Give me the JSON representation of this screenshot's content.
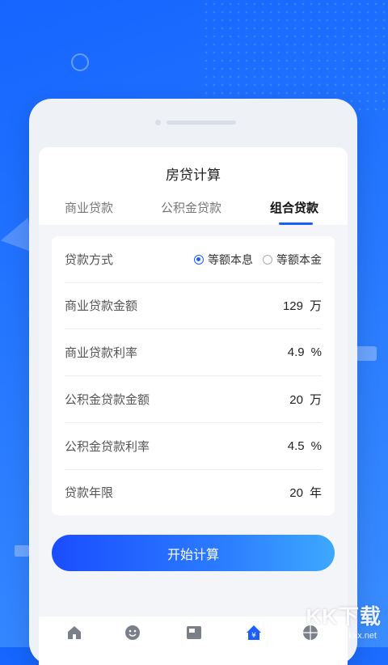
{
  "app": {
    "title": "房贷计算"
  },
  "tabs": [
    {
      "label": "商业贷款",
      "active": false
    },
    {
      "label": "公积金贷款",
      "active": false
    },
    {
      "label": "组合贷款",
      "active": true
    }
  ],
  "form": {
    "method": {
      "label": "贷款方式",
      "options": [
        "等额本息",
        "等额本金"
      ],
      "selected": "等额本息"
    },
    "rows": [
      {
        "label": "商业贷款金额",
        "value": "129",
        "unit": "万"
      },
      {
        "label": "商业贷款利率",
        "value": "4.9",
        "unit": "%"
      },
      {
        "label": "公积金贷款金额",
        "value": "20",
        "unit": "万"
      },
      {
        "label": "公积金贷款利率",
        "value": "4.5",
        "unit": "%"
      },
      {
        "label": "贷款年限",
        "value": "20",
        "unit": "年"
      }
    ]
  },
  "actions": {
    "calculate_label": "开始计算"
  },
  "nav": {
    "icons": [
      "home-icon",
      "smile-icon",
      "card-icon",
      "yuan-house-icon",
      "globe-icon"
    ]
  },
  "watermark": {
    "text": "KK下载",
    "url": "www.kkx.net"
  },
  "colors": {
    "accent": "#1a5eff",
    "background": "#1f6dff"
  }
}
